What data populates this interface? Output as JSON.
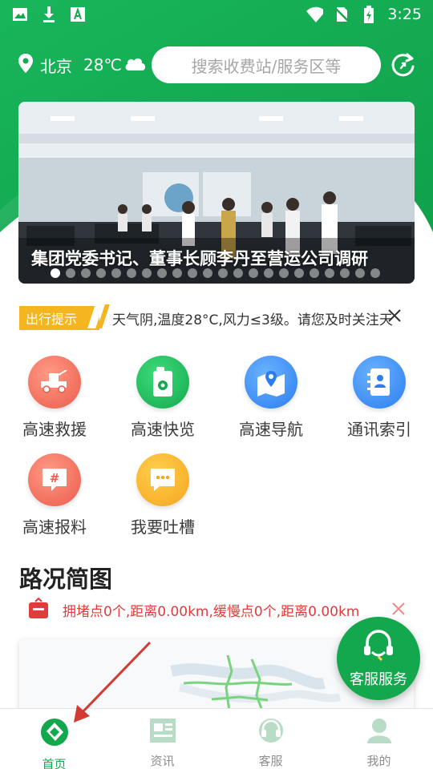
{
  "status_bar": {
    "time": "3:25"
  },
  "header": {
    "city": "北京",
    "temperature": "28℃",
    "search_placeholder": "搜索收费站/服务区等"
  },
  "banner": {
    "caption": "集团党委书记、董事长顾李丹至营运公司调研",
    "dot_count": 22,
    "active_index": 0
  },
  "tip": {
    "badge": "出行提示",
    "text": "天气阴,温度28°C,风力≤3级。请您及时关注天"
  },
  "services": [
    {
      "label": "高速救援",
      "icon": "tow-truck-icon",
      "color": "red"
    },
    {
      "label": "高速快览",
      "icon": "camera-phone-icon",
      "color": "green"
    },
    {
      "label": "高速导航",
      "icon": "map-pin-icon",
      "color": "blue"
    },
    {
      "label": "通讯索引",
      "icon": "contacts-icon",
      "color": "blue"
    },
    {
      "label": "高速报料",
      "icon": "hashtag-icon",
      "color": "red"
    },
    {
      "label": "我要吐槽",
      "icon": "chat-icon",
      "color": "orange"
    }
  ],
  "road": {
    "title": "路况简图",
    "alert": "拥堵点0个,距离0.00km,缓慢点0个,距离0.00km"
  },
  "fab": {
    "label": "客服服务"
  },
  "nav": [
    {
      "label": "首页",
      "active": true
    },
    {
      "label": "资讯",
      "active": false
    },
    {
      "label": "客服",
      "active": false
    },
    {
      "label": "我的",
      "active": false
    }
  ],
  "colors": {
    "brand_green": "#14a84e",
    "alert_red": "#e23b3b",
    "tip_yellow": "#f5b51e"
  }
}
